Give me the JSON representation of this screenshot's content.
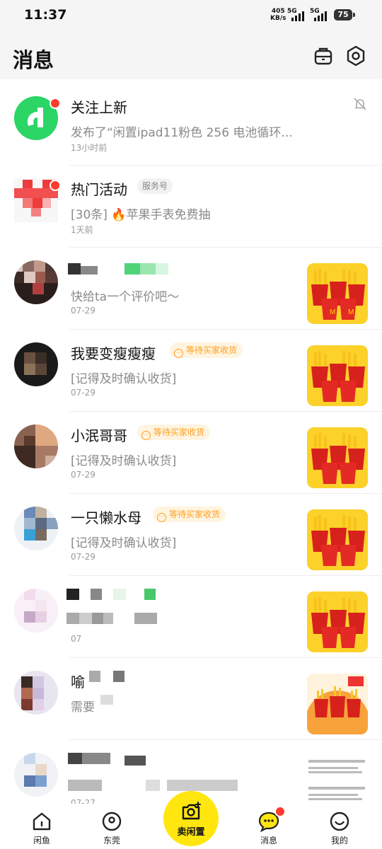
{
  "status_bar": {
    "time": "11:37",
    "net_speed_value": "405",
    "net_speed_unit": "KB/s",
    "signal_1": "5G",
    "signal_2": "5G",
    "battery": "75"
  },
  "header": {
    "title": "消息",
    "icons": [
      "cart-icon",
      "settings-icon"
    ]
  },
  "messages": [
    {
      "name": "关注上新",
      "preview": "发布了“闲置ipad11粉色 256 电池循环...",
      "time": "13小时前",
      "unread": true,
      "muted": true
    },
    {
      "name": "热门活动",
      "badge": "服务号",
      "preview": "[30条] 🔥苹果手表免费抽",
      "time": "1天前",
      "unread": true
    },
    {
      "name": "",
      "preview": "快给ta一个评价吧～",
      "time": "07-29"
    },
    {
      "name": "我要变瘦瘦瘦",
      "status": "等待买家收货",
      "preview": "[记得及时确认收货]",
      "time": "07-29"
    },
    {
      "name": "小泯哥哥",
      "status": "等待买家收货",
      "preview": "[记得及时确认收货]",
      "time": "07-29"
    },
    {
      "name": "一只懒水母",
      "status": "等待买家收货",
      "preview": "[记得及时确认收货]",
      "time": "07-29"
    },
    {
      "name": "",
      "preview": "",
      "time": "07"
    },
    {
      "name": "喻",
      "preview": "需要",
      "time": ""
    },
    {
      "name": "",
      "preview": "",
      "time": "07-27"
    }
  ],
  "tabbar": {
    "items": [
      {
        "label": "闲鱼",
        "icon": "home-icon"
      },
      {
        "label": "东莞",
        "icon": "location-icon"
      },
      {
        "label": "消息",
        "icon": "message-icon",
        "unread": true
      },
      {
        "label": "我的",
        "icon": "profile-icon"
      }
    ],
    "sell_label": "卖闲置"
  },
  "colors": {
    "brand_yellow": "#ffe60f",
    "unread_red": "#ff3b30",
    "status_orange": "#ff9f1c"
  }
}
